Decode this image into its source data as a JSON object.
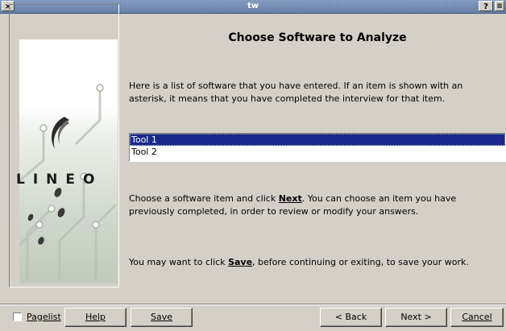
{
  "window": {
    "title": "tw",
    "close_label": "×",
    "help_label": "?",
    "menu_label": "≡"
  },
  "branding": {
    "logo_text": "LINEO"
  },
  "main": {
    "heading": "Choose Software to Analyze",
    "intro": "Here is a list of software that you have entered. If an item is shown with an asterisk, it means that you have completed the interview for that item.",
    "list": {
      "items": [
        "Tool 1",
        "Tool 2"
      ],
      "selected_index": 0
    },
    "instruction": {
      "before": "Choose a software item and click ",
      "keyword": "Next",
      "after": ". You can choose an item you have previously completed, in order to review or modify your answers."
    },
    "hint": {
      "before": "You may want to click ",
      "keyword": "Save",
      "after": ", before continuing or exiting, to save your work."
    }
  },
  "footer": {
    "pagelist_label": "Pagelist",
    "pagelist_checked": false,
    "help_label": "Help",
    "save_label": "Save",
    "back_label": "< Back",
    "next_label": "Next >",
    "cancel_label": "Cancel"
  }
}
